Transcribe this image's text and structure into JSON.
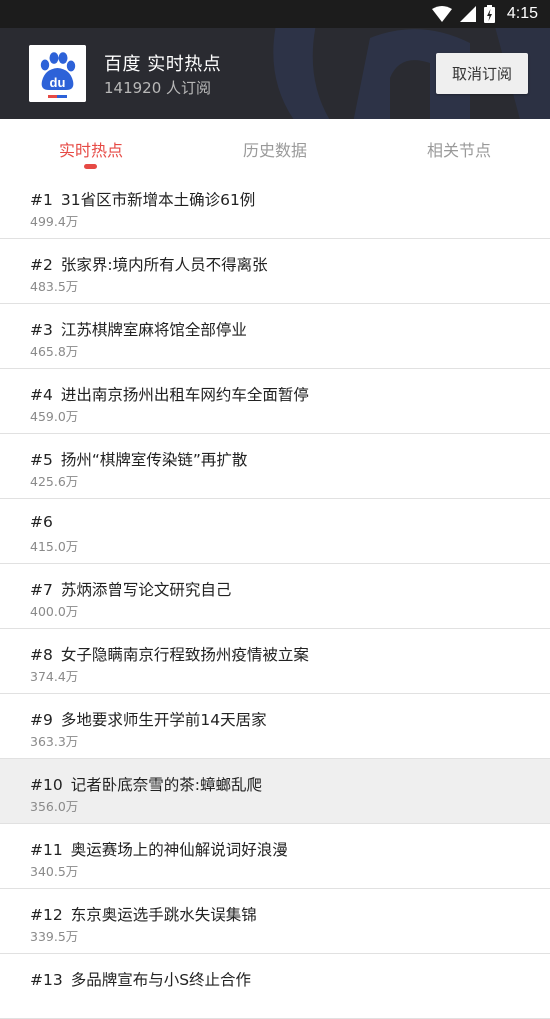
{
  "status_bar": {
    "time": "4:15"
  },
  "header": {
    "title": "百度 实时热点",
    "subscribers": "141920 人订阅",
    "unsubscribe_label": "取消订阅"
  },
  "tabs": [
    {
      "label": "实时热点",
      "active": true
    },
    {
      "label": "历史数据",
      "active": false
    },
    {
      "label": "相关节点",
      "active": false
    }
  ],
  "items": [
    {
      "rank": "#1",
      "title": "31省区市新增本土确诊61例",
      "heat": "499.4万"
    },
    {
      "rank": "#2",
      "title": "张家界:境内所有人员不得离张",
      "heat": "483.5万"
    },
    {
      "rank": "#3",
      "title": "江苏棋牌室麻将馆全部停业",
      "heat": "465.8万"
    },
    {
      "rank": "#4",
      "title": "进出南京扬州出租车网约车全面暂停",
      "heat": "459.0万"
    },
    {
      "rank": "#5",
      "title": "扬州“棋牌室传染链”再扩散",
      "heat": "425.6万"
    },
    {
      "rank": "#6",
      "title": "",
      "heat": "415.0万"
    },
    {
      "rank": "#7",
      "title": "苏炳添曾写论文研究自己",
      "heat": "400.0万"
    },
    {
      "rank": "#8",
      "title": "女子隐瞒南京行程致扬州疫情被立案",
      "heat": "374.4万"
    },
    {
      "rank": "#9",
      "title": "多地要求师生开学前14天居家",
      "heat": "363.3万"
    },
    {
      "rank": "#10",
      "title": "记者卧底奈雪的茶:蟑螂乱爬",
      "heat": "356.0万",
      "highlighted": true
    },
    {
      "rank": "#11",
      "title": "奥运赛场上的神仙解说词好浪漫",
      "heat": "340.5万"
    },
    {
      "rank": "#12",
      "title": "东京奥运选手跳水失误集锦",
      "heat": "339.5万"
    },
    {
      "rank": "#13",
      "title": "多品牌宣布与小S终止合作",
      "heat": ""
    }
  ],
  "colors": {
    "accent": "#e64a45",
    "header_bg": "#2a2b31",
    "status_bar_bg": "#1c1c1c"
  },
  "icons": [
    "wifi-icon",
    "signal-icon",
    "battery-icon",
    "baidu-logo-icon"
  ]
}
